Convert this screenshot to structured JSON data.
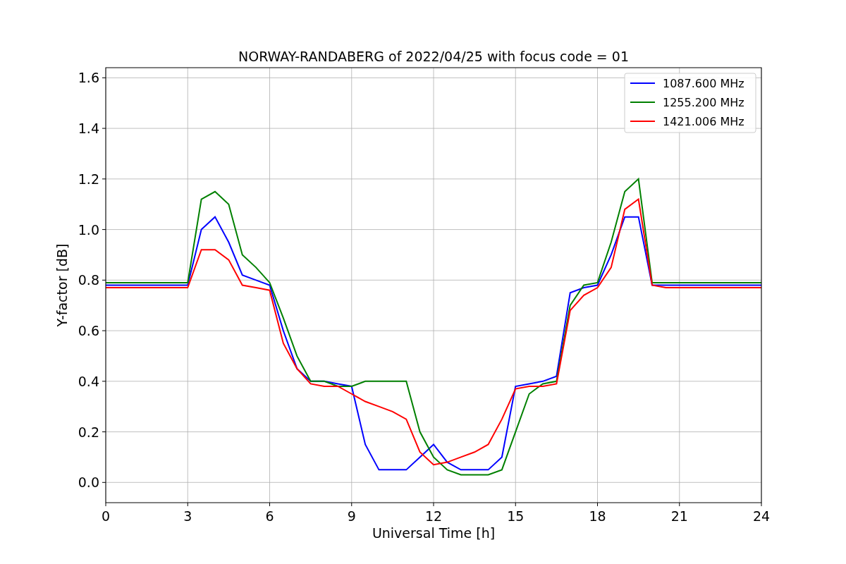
{
  "chart_data": {
    "type": "line",
    "title": "NORWAY-RANDABERG of 2022/04/25 with focus code = 01",
    "xlabel": "Universal Time [h]",
    "ylabel": "Y-factor [dB]",
    "x": [
      0,
      0.5,
      1,
      1.5,
      2,
      2.5,
      3,
      3.5,
      4,
      4.5,
      5,
      5.5,
      6,
      6.5,
      7,
      7.5,
      8,
      8.5,
      9,
      9.5,
      10,
      10.5,
      11,
      11.5,
      12,
      12.5,
      13,
      13.5,
      14,
      14.5,
      15,
      15.5,
      16,
      16.5,
      17,
      17.5,
      18,
      18.5,
      19,
      19.5,
      20,
      20.5,
      21,
      21.5,
      22,
      22.5,
      23,
      23.5,
      24
    ],
    "series": [
      {
        "name": "1087.600 MHz",
        "color": "#0000ff",
        "values": [
          0.78,
          0.78,
          0.78,
          0.78,
          0.78,
          0.78,
          0.78,
          1.0,
          1.05,
          0.95,
          0.82,
          0.8,
          0.78,
          0.6,
          0.45,
          0.4,
          0.4,
          0.39,
          0.38,
          0.15,
          0.05,
          0.05,
          0.05,
          0.1,
          0.15,
          0.08,
          0.05,
          0.05,
          0.05,
          0.1,
          0.38,
          0.39,
          0.4,
          0.42,
          0.75,
          0.77,
          0.78,
          0.9,
          1.05,
          1.05,
          0.78,
          0.78,
          0.78,
          0.78,
          0.78,
          0.78,
          0.78,
          0.78,
          0.78
        ]
      },
      {
        "name": "1255.200 MHz",
        "color": "#008000",
        "values": [
          0.79,
          0.79,
          0.79,
          0.79,
          0.79,
          0.79,
          0.79,
          1.12,
          1.15,
          1.1,
          0.9,
          0.85,
          0.79,
          0.65,
          0.5,
          0.4,
          0.4,
          0.38,
          0.38,
          0.4,
          0.4,
          0.4,
          0.4,
          0.2,
          0.1,
          0.05,
          0.03,
          0.03,
          0.03,
          0.05,
          0.2,
          0.35,
          0.39,
          0.4,
          0.7,
          0.78,
          0.79,
          0.95,
          1.15,
          1.2,
          0.79,
          0.79,
          0.79,
          0.79,
          0.79,
          0.79,
          0.79,
          0.79,
          0.79
        ]
      },
      {
        "name": "1421.006 MHz",
        "color": "#ff0000",
        "values": [
          0.77,
          0.77,
          0.77,
          0.77,
          0.77,
          0.77,
          0.77,
          0.92,
          0.92,
          0.88,
          0.78,
          0.77,
          0.76,
          0.55,
          0.45,
          0.39,
          0.38,
          0.38,
          0.35,
          0.32,
          0.3,
          0.28,
          0.25,
          0.12,
          0.07,
          0.08,
          0.1,
          0.12,
          0.15,
          0.25,
          0.37,
          0.38,
          0.38,
          0.39,
          0.68,
          0.74,
          0.77,
          0.85,
          1.08,
          1.12,
          0.78,
          0.77,
          0.77,
          0.77,
          0.77,
          0.77,
          0.77,
          0.77,
          0.77
        ]
      }
    ],
    "grid": true,
    "legend": true,
    "xlim": [
      0,
      24
    ],
    "ylim": [
      -0.08,
      1.64
    ],
    "xticks": [
      0,
      3,
      6,
      9,
      12,
      15,
      18,
      21,
      24
    ],
    "yticks": [
      {
        "value": 0,
        "label": "0.0"
      },
      {
        "value": 0.2,
        "label": "0.2"
      },
      {
        "value": 0.4,
        "label": "0.4"
      },
      {
        "value": 0.6,
        "label": "0.6"
      },
      {
        "value": 0.8,
        "label": "0.8"
      },
      {
        "value": 1,
        "label": "1.0"
      },
      {
        "value": 1.2,
        "label": "1.2"
      },
      {
        "value": 1.4,
        "label": "1.4"
      },
      {
        "value": 1.6,
        "label": "1.6"
      }
    ]
  }
}
